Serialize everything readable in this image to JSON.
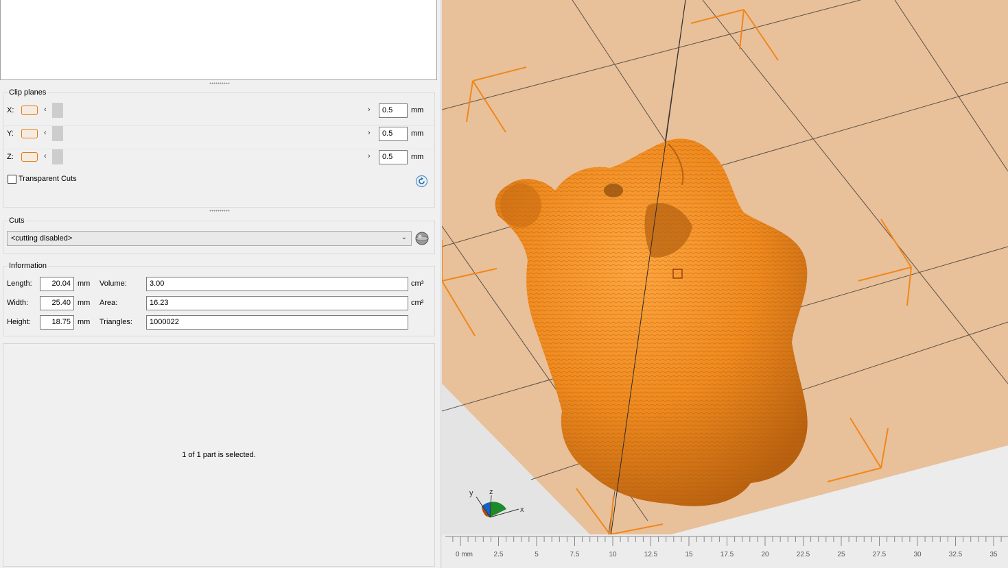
{
  "clip_planes": {
    "title": "Clip planes",
    "rows": [
      {
        "axis": "X:",
        "value": "0.5",
        "unit": "mm"
      },
      {
        "axis": "Y:",
        "value": "0.5",
        "unit": "mm"
      },
      {
        "axis": "Z:",
        "value": "0.5",
        "unit": "mm"
      }
    ],
    "transparent_cuts_label": "Transparent Cuts",
    "transparent_cuts_checked": false,
    "left_arrow": "‹",
    "right_arrow": "›"
  },
  "cuts": {
    "title": "Cuts",
    "selected": "<cutting disabled>"
  },
  "information": {
    "title": "Information",
    "length_label": "Length:",
    "length_value": "20.04",
    "length_unit": "mm",
    "width_label": "Width:",
    "width_value": "25.40",
    "width_unit": "mm",
    "height_label": "Height:",
    "height_value": "18.75",
    "height_unit": "mm",
    "volume_label": "Volume:",
    "volume_value": "3.00",
    "volume_unit": "cm³",
    "area_label": "Area:",
    "area_value": "16.23",
    "area_unit": "cm²",
    "triangles_label": "Triangles:",
    "triangles_value": "1000022"
  },
  "status": "1 of 1 part is selected.",
  "axes_gizmo": {
    "x": "x",
    "y": "y",
    "z": "z"
  },
  "ruler": {
    "labels": [
      "0 mm",
      "2.5",
      "5",
      "7.5",
      "10",
      "12.5",
      "15",
      "17.5",
      "20",
      "22.5",
      "25",
      "27.5",
      "30",
      "32.5",
      "35"
    ]
  },
  "colors": {
    "model": "#f08a1e",
    "bed": "#e8c09a",
    "accent": "#e07d10"
  }
}
